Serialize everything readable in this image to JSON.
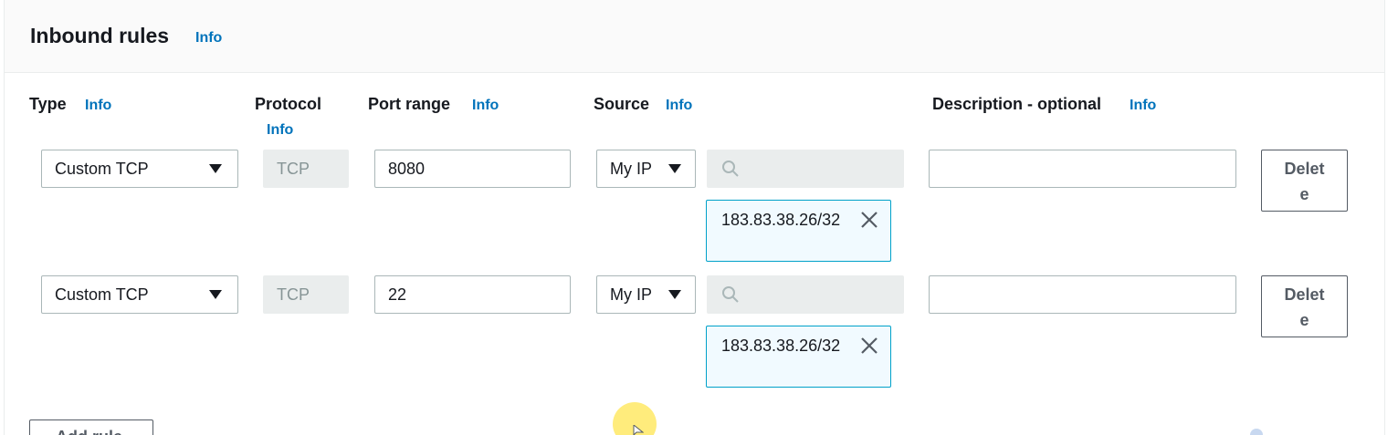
{
  "section": {
    "title": "Inbound rules",
    "info": "Info"
  },
  "columns": {
    "type": "Type",
    "protocol": "Protocol",
    "port_range": "Port range",
    "source": "Source",
    "description": "Description - optional",
    "info": "Info"
  },
  "rules": [
    {
      "type": "Custom TCP",
      "protocol": "TCP",
      "port_range": "8080",
      "source_type": "My IP",
      "source_token": "183.83.38.26/32",
      "description": "",
      "delete_label": "Delete"
    },
    {
      "type": "Custom TCP",
      "protocol": "TCP",
      "port_range": "22",
      "source_type": "My IP",
      "source_token": "183.83.38.26/32",
      "description": "",
      "delete_label": "Delete"
    }
  ],
  "actions": {
    "add_rule": "Add rule"
  },
  "icons": {
    "caret": "caret-down-icon",
    "search": "search-icon",
    "remove": "close-icon"
  },
  "colors": {
    "link": "#0073bb",
    "token_border": "#00a1c9",
    "token_bg": "#f1faff",
    "disabled_bg": "#eaeded"
  }
}
